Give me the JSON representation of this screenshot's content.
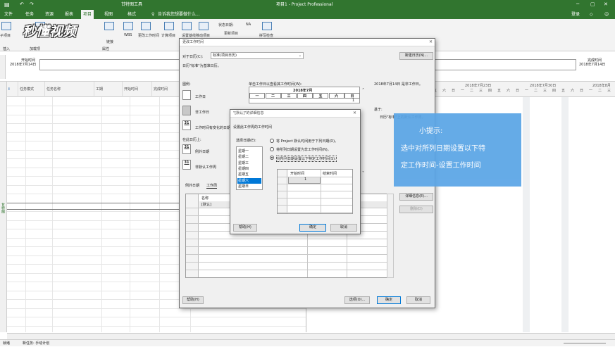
{
  "app": {
    "title": "项目1 - Project Professional",
    "context_tab": "甘特图工具",
    "tell_me": "告诉我您想要做什么...",
    "login": "登录"
  },
  "menu": [
    "文件",
    "任务",
    "资源",
    "报表",
    "项目",
    "视图",
    "格式"
  ],
  "ribbon": {
    "groups": [
      "插入",
      "加载项",
      "属性"
    ],
    "buttons": [
      "子项目",
      "项目信息",
      "自定义字段",
      "链接",
      "WBS",
      "更改工作时间",
      "计算项目",
      "设置基线",
      "移动项目",
      "拼写检查"
    ],
    "status_date_label": "状态日期:",
    "status_date_value": "NA",
    "update_project": "更新项目",
    "watermark": "秒懂视频"
  },
  "timeline": {
    "start_label": "开始时间",
    "start_date": "2018年7月14日",
    "finish_label": "完成时间",
    "finish_date": "2018年7月14日"
  },
  "grid": {
    "columns": [
      "任务模式",
      "任务名称",
      "工期",
      "开始时间",
      "完成时间"
    ],
    "side_label": "甘特图"
  },
  "gantt": {
    "weeks": [
      "2018年7月23日",
      "2018年7月30日",
      "2018年8月"
    ],
    "days": [
      "五",
      "六",
      "日",
      "一",
      "二",
      "三",
      "四",
      "五",
      "六",
      "日",
      "一",
      "二",
      "三",
      "四",
      "五",
      "六",
      "日",
      "一",
      "二",
      "三"
    ]
  },
  "status": {
    "left": "就绪",
    "new_task": "新任务: 手动计划"
  },
  "change_dialog": {
    "title": "更改工作时间",
    "for_calendar_label": "对于日历(C):",
    "calendar_value": "标准(项目日历)",
    "new_calendar_btn": "新建日历(N)...",
    "base_note": "日历\"标准\"为基准日历。",
    "legend_title": "图例:",
    "legend_items": [
      "工作日",
      "非工作日",
      "工作时间有变化的日期"
    ],
    "on_calendar": "在此日历上:",
    "exception_day": "例外日期",
    "nondefault_week": "非默认工作周",
    "click_hint": "单击工作日以查看其工作时间(W):",
    "date_info": "2018年7月14日 是非工作日。",
    "based_on": "基于:",
    "based_on_text": "日历\"标准\"上的默认工作周。",
    "month_title": "2018年7月",
    "weekdays": [
      "一",
      "二",
      "三",
      "四",
      "五",
      "六",
      "日"
    ],
    "first_day": "1",
    "day_num_31": "31",
    "tabs": [
      "例外日期",
      "工作周"
    ],
    "table_header": "名称",
    "table_row1": "[默认]",
    "details_btn": "详细信息(E)...",
    "delete_btn": "删除(D)",
    "help_btn": "帮助(H)",
    "options_btn": "选项(O)...",
    "ok_btn": "确定",
    "cancel_btn": "取消"
  },
  "detail_dialog": {
    "title": "\"[默认]\"的详细信息",
    "subtitle": "设置此工作周的工作时间",
    "select_days_label": "选择日期(E):",
    "days": [
      "星期一",
      "星期二",
      "星期三",
      "星期四",
      "星期五",
      "星期六",
      "星期日"
    ],
    "selected_day": "星期六",
    "options": [
      "将 Project 默认时间用于下列日期(D)。",
      "将所列日期设置为非工作时间(N)。",
      "对所列日期设置以下特定工作时间(S):"
    ],
    "col_start": "开始时间",
    "col_end": "结束时间",
    "row1_num": "1",
    "help_btn": "帮助(H)",
    "ok_btn": "确定",
    "cancel_btn": "取消"
  },
  "tip": {
    "title": "小提示:",
    "line1": "选中对所列日期设置以下特",
    "line2": "定工作时间-设置工作时间"
  },
  "colors": {
    "app_green": "#31752f",
    "tip_blue": "#5aa5e6",
    "selection_blue": "#0078d7"
  }
}
